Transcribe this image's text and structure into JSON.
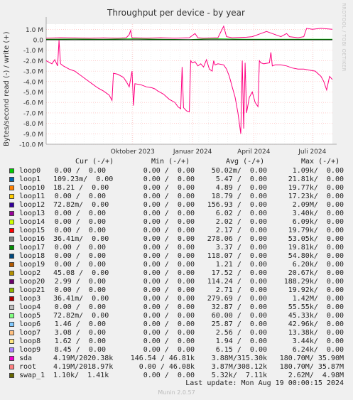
{
  "chart_data": {
    "type": "line",
    "title": "Throughput per device - by year",
    "ylabel": "Bytes/second read (-) / write (+)",
    "ylim": [
      -10000000,
      1500000
    ],
    "ytick_labels": [
      "1.0 M",
      "0.0",
      "-1.0 M",
      "-2.0 M",
      "-3.0 M",
      "-4.0 M",
      "-5.0 M",
      "-6.0 M",
      "-7.0 M",
      "-8.0 M",
      "-9.0 M",
      "-10.0 M"
    ],
    "yticks": [
      1000000,
      0,
      -1000000,
      -2000000,
      -3000000,
      -4000000,
      -5000000,
      -6000000,
      -7000000,
      -8000000,
      -9000000,
      -10000000
    ],
    "x_ticks": [
      {
        "label": "Oktober 2023",
        "value": 0.325
      },
      {
        "label": "Januar 2024",
        "value": 0.55
      },
      {
        "label": "April 2024",
        "value": 0.78
      },
      {
        "label": "Juli 2024",
        "value": 1.0
      }
    ],
    "xlim": [
      0.0,
      1.0
    ],
    "grid": true,
    "series": [
      {
        "name": "sda",
        "color": "#00cc00",
        "write": [
          [
            0.0,
            0.05
          ],
          [
            0.1,
            0.08
          ],
          [
            0.2,
            0.05
          ],
          [
            0.3,
            0.1
          ],
          [
            0.4,
            0.05
          ],
          [
            0.5,
            0.02
          ],
          [
            0.55,
            0.08
          ],
          [
            0.6,
            0.1
          ],
          [
            0.7,
            0.05
          ],
          [
            0.8,
            0.05
          ],
          [
            0.9,
            0.05
          ],
          [
            1.0,
            0.05
          ]
        ]
      },
      {
        "name": "root",
        "color": "#ff0080",
        "write": [
          [
            0.0,
            0.15
          ],
          [
            0.05,
            0.2
          ],
          [
            0.1,
            0.18
          ],
          [
            0.15,
            0.15
          ],
          [
            0.2,
            0.18
          ],
          [
            0.25,
            0.15
          ],
          [
            0.28,
            0.2
          ],
          [
            0.29,
            0.5
          ],
          [
            0.295,
            0.9
          ],
          [
            0.3,
            0.2
          ],
          [
            0.35,
            0.15
          ],
          [
            0.4,
            0.2
          ],
          [
            0.45,
            0.15
          ],
          [
            0.5,
            0.2
          ],
          [
            0.52,
            0.6
          ],
          [
            0.53,
            0.2
          ],
          [
            0.55,
            0.15
          ],
          [
            0.6,
            0.2
          ],
          [
            0.62,
            1.3
          ],
          [
            0.63,
            0.3
          ],
          [
            0.65,
            0.2
          ],
          [
            0.7,
            0.25
          ],
          [
            0.72,
            0.3
          ],
          [
            0.75,
            0.6
          ],
          [
            0.77,
            0.8
          ],
          [
            0.8,
            0.5
          ],
          [
            0.82,
            0.3
          ],
          [
            0.84,
            0.6
          ],
          [
            0.85,
            0.3
          ],
          [
            0.88,
            0.2
          ],
          [
            0.9,
            0.3
          ],
          [
            0.91,
            1.1
          ],
          [
            0.93,
            1.0
          ],
          [
            0.96,
            1.1
          ],
          [
            1.0,
            1.0
          ]
        ],
        "read": [
          [
            0.0,
            -2.0
          ],
          [
            0.02,
            -2.3
          ],
          [
            0.03,
            -1.9
          ],
          [
            0.04,
            -2.5
          ],
          [
            0.045,
            -0.05
          ],
          [
            0.05,
            -2.3
          ],
          [
            0.06,
            -2.5
          ],
          [
            0.08,
            -2.8
          ],
          [
            0.1,
            -3.0
          ],
          [
            0.12,
            -3.4
          ],
          [
            0.14,
            -3.8
          ],
          [
            0.16,
            -4.2
          ],
          [
            0.18,
            -4.6
          ],
          [
            0.2,
            -4.9
          ],
          [
            0.22,
            -5.3
          ],
          [
            0.23,
            -5.8
          ],
          [
            0.235,
            -3.2
          ],
          [
            0.25,
            -3.3
          ],
          [
            0.27,
            -3.6
          ],
          [
            0.28,
            -4.0
          ],
          [
            0.29,
            -4.5
          ],
          [
            0.3,
            -3.0
          ],
          [
            0.305,
            -6.3
          ],
          [
            0.31,
            -4.2
          ],
          [
            0.33,
            -4.3
          ],
          [
            0.35,
            -4.5
          ],
          [
            0.37,
            -4.6
          ],
          [
            0.38,
            -4.7
          ],
          [
            0.39,
            -4.9
          ],
          [
            0.41,
            -5.2
          ],
          [
            0.43,
            -5.7
          ],
          [
            0.45,
            -6.0
          ],
          [
            0.46,
            -6.4
          ],
          [
            0.47,
            -6.6
          ],
          [
            0.475,
            -2.6
          ],
          [
            0.48,
            -6.5
          ],
          [
            0.49,
            -6.8
          ],
          [
            0.5,
            -6.9
          ],
          [
            0.505,
            -2.0
          ],
          [
            0.51,
            -2.2
          ],
          [
            0.52,
            -2.1
          ],
          [
            0.53,
            -2.5
          ],
          [
            0.54,
            -2.3
          ],
          [
            0.55,
            -2.6
          ],
          [
            0.56,
            -1.9
          ],
          [
            0.57,
            -2.8
          ],
          [
            0.58,
            -3.0
          ],
          [
            0.585,
            -2.0
          ],
          [
            0.59,
            -2.4
          ],
          [
            0.6,
            -2.3
          ],
          [
            0.62,
            -2.4
          ],
          [
            0.63,
            -2.8
          ],
          [
            0.64,
            -3.5
          ],
          [
            0.65,
            -4.5
          ],
          [
            0.66,
            -5.5
          ],
          [
            0.67,
            -7.0
          ],
          [
            0.675,
            -8.0
          ],
          [
            0.68,
            -9.0
          ],
          [
            0.685,
            -2.0
          ],
          [
            0.69,
            -8.5
          ],
          [
            0.695,
            -2.2
          ],
          [
            0.7,
            -7.0
          ],
          [
            0.71,
            -5.5
          ],
          [
            0.72,
            -5.0
          ],
          [
            0.73,
            -6.0
          ],
          [
            0.74,
            -6.4
          ],
          [
            0.745,
            -2.0
          ],
          [
            0.75,
            -2.2
          ],
          [
            0.76,
            -2.3
          ],
          [
            0.78,
            -2.2
          ],
          [
            0.785,
            -1.2
          ],
          [
            0.79,
            -2.5
          ],
          [
            0.8,
            -2.4
          ],
          [
            0.82,
            -2.4
          ],
          [
            0.84,
            -2.5
          ],
          [
            0.86,
            -2.7
          ],
          [
            0.88,
            -2.8
          ],
          [
            0.9,
            -2.8
          ],
          [
            0.92,
            -2.9
          ],
          [
            0.94,
            -3.0
          ],
          [
            0.96,
            -3.5
          ],
          [
            0.97,
            -4.0
          ],
          [
            0.98,
            -4.8
          ],
          [
            0.99,
            -3.5
          ],
          [
            1.0,
            -3.8
          ]
        ]
      }
    ]
  },
  "side_label": "RRDTOOL / TOBI OETIKER",
  "legend": {
    "headers": {
      "cur": "Cur (-/+)",
      "min": "Min (-/+)",
      "avg": "Avg (-/+)",
      "max": "Max (-/+)"
    },
    "rows": [
      {
        "name": "loop0",
        "color": "#00cc00",
        "cur": "0.00 /  0.00",
        "min": "0.00 /  0.00",
        "avg": "50.02m/  0.00",
        "max": "1.09k/  0.00"
      },
      {
        "name": "loop1",
        "color": "#0066b3",
        "cur": "109.23m/  0.00",
        "min": "0.00 /  0.00",
        "avg": "5.47 /  0.00",
        "max": "21.81k/  0.00"
      },
      {
        "name": "loop10",
        "color": "#ff8000",
        "cur": "18.21 /  0.00",
        "min": "0.00 /  0.00",
        "avg": "4.89 /  0.00",
        "max": "19.77k/  0.00"
      },
      {
        "name": "loop11",
        "color": "#ffcc00",
        "cur": "0.00 /  0.00",
        "min": "0.00 /  0.00",
        "avg": "18.79 /  0.00",
        "max": "17.23k/  0.00"
      },
      {
        "name": "loop12",
        "color": "#330099",
        "cur": "72.82m/  0.00",
        "min": "0.00 /  0.00",
        "avg": "156.93 /  0.00",
        "max": "2.09M/  0.00"
      },
      {
        "name": "loop13",
        "color": "#990099",
        "cur": "0.00 /  0.00",
        "min": "0.00 /  0.00",
        "avg": "6.02 /  0.00",
        "max": "3.40k/  0.00"
      },
      {
        "name": "loop14",
        "color": "#ccff00",
        "cur": "0.00 /  0.00",
        "min": "0.00 /  0.00",
        "avg": "2.02 /  0.00",
        "max": "6.09k/  0.00"
      },
      {
        "name": "loop15",
        "color": "#ff0000",
        "cur": "0.00 /  0.00",
        "min": "0.00 /  0.00",
        "avg": "2.17 /  0.00",
        "max": "19.79k/  0.00"
      },
      {
        "name": "loop16",
        "color": "#808080",
        "cur": "36.41m/  0.00",
        "min": "0.00 /  0.00",
        "avg": "278.06 /  0.00",
        "max": "53.05k/  0.00"
      },
      {
        "name": "loop17",
        "color": "#008f00",
        "cur": "0.00 /  0.00",
        "min": "0.00 /  0.00",
        "avg": "3.37 /  0.00",
        "max": "19.81k/  0.00"
      },
      {
        "name": "loop18",
        "color": "#00487d",
        "cur": "0.00 /  0.00",
        "min": "0.00 /  0.00",
        "avg": "118.07 /  0.00",
        "max": "54.80k/  0.00"
      },
      {
        "name": "loop19",
        "color": "#b35a00",
        "cur": "0.00 /  0.00",
        "min": "0.00 /  0.00",
        "avg": "1.21 /  0.00",
        "max": "6.20k/  0.00"
      },
      {
        "name": "loop2",
        "color": "#b38f00",
        "cur": "45.08 /  0.00",
        "min": "0.00 /  0.00",
        "avg": "17.52 /  0.00",
        "max": "20.67k/  0.00"
      },
      {
        "name": "loop20",
        "color": "#6b006b",
        "cur": "2.99 /  0.00",
        "min": "0.00 /  0.00",
        "avg": "114.24 /  0.00",
        "max": "188.29k/  0.00"
      },
      {
        "name": "loop21",
        "color": "#8fb300",
        "cur": "0.00 /  0.00",
        "min": "0.00 /  0.00",
        "avg": "2.71 /  0.00",
        "max": "19.92k/  0.00"
      },
      {
        "name": "loop3",
        "color": "#b30000",
        "cur": "36.41m/  0.00",
        "min": "0.00 /  0.00",
        "avg": "279.69 /  0.00",
        "max": "1.42M/  0.00"
      },
      {
        "name": "loop4",
        "color": "#bebebe",
        "cur": "0.00 /  0.00",
        "min": "0.00 /  0.00",
        "avg": "32.87 /  0.00",
        "max": "55.55k/  0.00"
      },
      {
        "name": "loop5",
        "color": "#80ff80",
        "cur": "72.82m/  0.00",
        "min": "0.00 /  0.00",
        "avg": "60.00 /  0.00",
        "max": "45.33k/  0.00"
      },
      {
        "name": "loop6",
        "color": "#80c9ff",
        "cur": "1.46 /  0.00",
        "min": "0.00 /  0.00",
        "avg": "25.87 /  0.00",
        "max": "42.96k/  0.00"
      },
      {
        "name": "loop7",
        "color": "#ffc080",
        "cur": "3.08 /  0.00",
        "min": "0.00 /  0.00",
        "avg": "2.56 /  0.00",
        "max": "13.38k/  0.00"
      },
      {
        "name": "loop8",
        "color": "#ffe680",
        "cur": "1.62 /  0.00",
        "min": "0.00 /  0.00",
        "avg": "1.94 /  0.00",
        "max": "3.44k/  0.00"
      },
      {
        "name": "loop9",
        "color": "#aa80ff",
        "cur": "8.45 /  0.00",
        "min": "0.00 /  0.00",
        "avg": "6.15 /  0.00",
        "max": "6.24k/  0.00"
      },
      {
        "name": "sda",
        "color": "#ee00cc",
        "cur": "4.19M/2020.38k",
        "min": "146.54 / 46.81k",
        "avg": "3.88M/315.30k",
        "max": "180.70M/ 35.90M"
      },
      {
        "name": "root",
        "color": "#ff8080",
        "cur": "4.19M/2018.97k",
        "min": "0.00 / 46.08k",
        "avg": "3.87M/308.12k",
        "max": "180.70M/ 35.87M"
      },
      {
        "name": "swap_1",
        "color": "#666600",
        "cur": "1.10k/  1.41k",
        "min": "0.00 /  0.00",
        "avg": "5.32k/  7.11k",
        "max": "2.62M/  4.98M"
      }
    ]
  },
  "last_update": "Last update: Mon Aug 19 00:00:15 2024",
  "footer": "Munin 2.0.57"
}
